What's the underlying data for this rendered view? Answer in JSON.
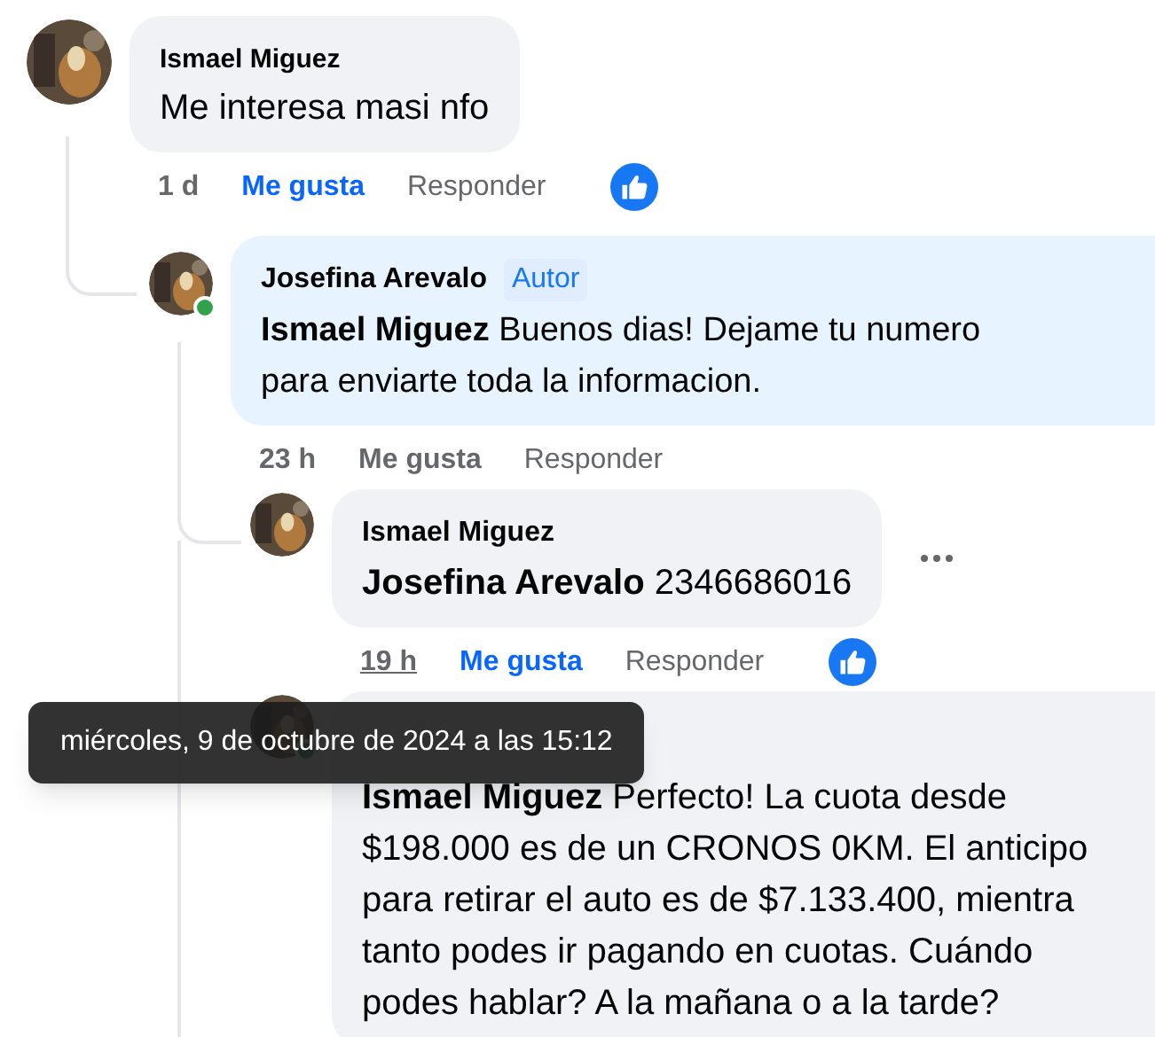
{
  "comments": [
    {
      "author": "Ismael Miguez",
      "lines": [
        "Me interesa masi nfo"
      ],
      "actions": {
        "time": "1 d",
        "time_hovered": false,
        "like": "Me gusta",
        "liked": true,
        "reply": "Responder",
        "has_reaction": true
      },
      "children": [
        {
          "author": "Josefina Arevalo",
          "badge": "Autor",
          "online": true,
          "highlighted": true,
          "lines": [
            "**Ismael Miguez** Buenos dias! Dejame tu numero",
            "para enviarte toda la informacion."
          ],
          "actions": {
            "time": "23 h",
            "time_hovered": false,
            "like": "Me gusta",
            "liked": false,
            "reply": "Responder"
          },
          "children": [
            {
              "author": "Ismael Miguez",
              "lines": [
                "**Josefina Arevalo** 2346686016"
              ],
              "actions": {
                "time": "19 h",
                "time_hovered": true,
                "like": "Me gusta",
                "liked": true,
                "reply": "Responder",
                "has_reaction": true
              },
              "more_menu": true
            },
            {
              "online": true,
              "lines": [
                "**Ismael Miguez** Perfecto! La cuota desde",
                "$198.000 es de un CRONOS 0KM. El anticipo",
                "para retirar el auto es de $7.133.400, mientra",
                "tanto podes ir pagando en cuotas. Cuándo",
                "podes hablar? A la mañana o a la tarde?"
              ]
            }
          ]
        }
      ]
    }
  ],
  "tooltip": {
    "text": "miércoles, 9 de octubre de 2024 a las 15:12"
  }
}
